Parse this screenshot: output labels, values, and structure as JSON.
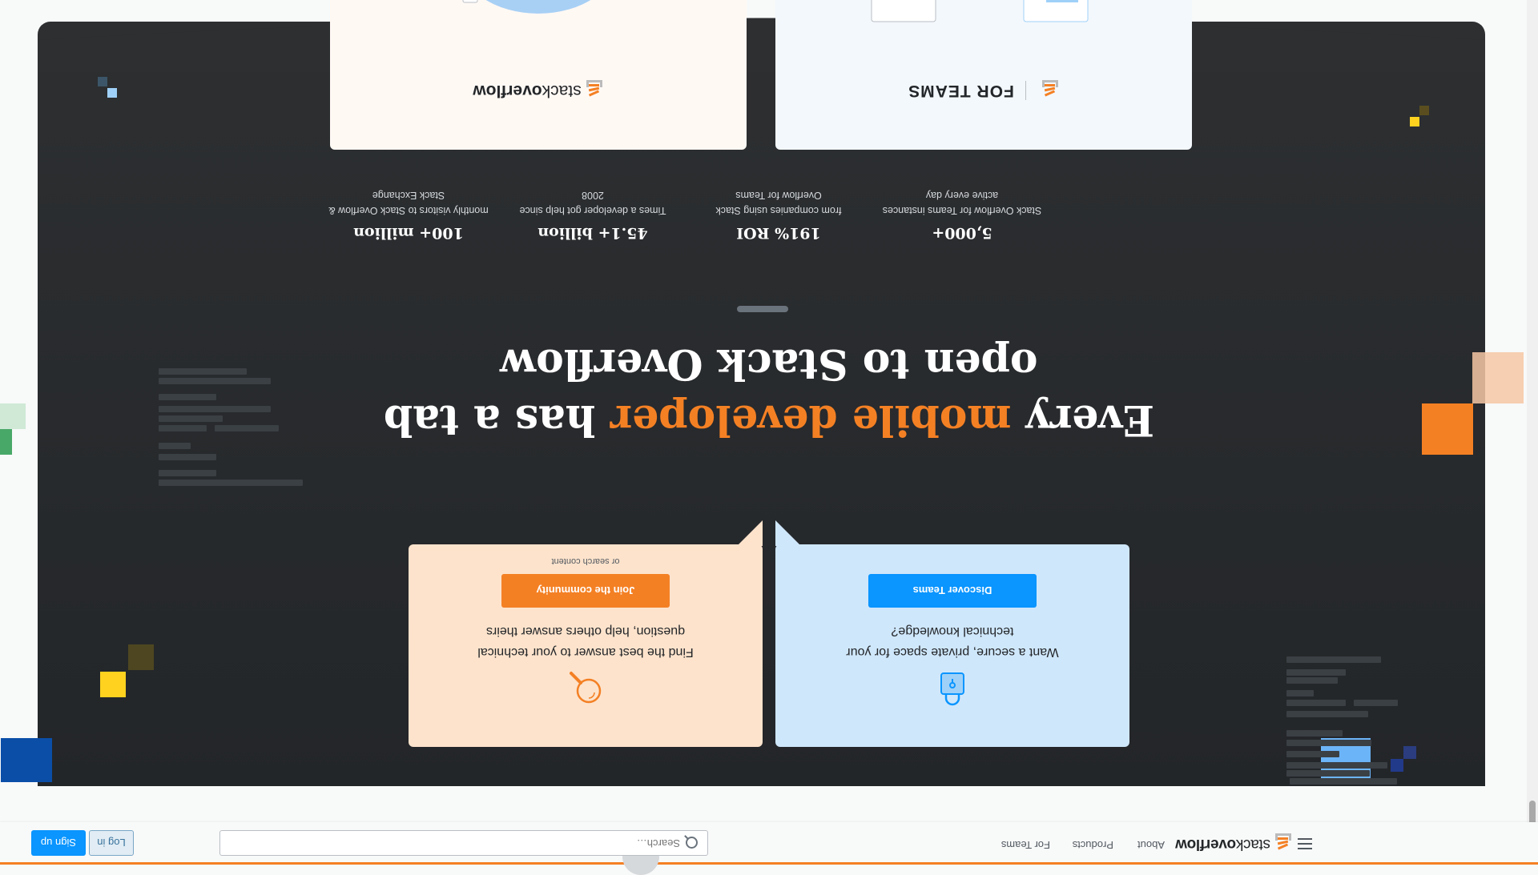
{
  "topbar": {
    "logo_light": "stack",
    "logo_bold": "overflow",
    "nav": [
      "About",
      "Products",
      "For Teams"
    ],
    "search_placeholder": "Search…",
    "login_label": "Log in",
    "signup_label": "Sign up",
    "close_glyph": "×"
  },
  "hero": {
    "headline_pre": "Every ",
    "headline_accent": "mobile developer",
    "headline_post": " has a tab open to Stack Overflow"
  },
  "cards": {
    "teams": {
      "icon": "lock-icon",
      "description": "Want a secure, private space for your technical knowledge?",
      "cta": "Discover Teams"
    },
    "community": {
      "icon": "search-icon",
      "description": "Find the best answer to your technical question, help others answer theirs",
      "cta": "Join the community",
      "sub": "or search content"
    }
  },
  "stats": [
    {
      "number": "100+ million",
      "label": "monthly visitors to Stack Overflow & Stack Exchange"
    },
    {
      "number": "45.1+ billion",
      "label": "Times a developer got help since 2008"
    },
    {
      "number": "191% ROI",
      "label": "from companies using Stack Overflow for Teams"
    },
    {
      "number": "5,000+",
      "label": "Stack Overflow for Teams instances active every day"
    }
  ],
  "promos": {
    "teams_label": "FOR TEAMS",
    "so_light": "stack",
    "so_bold": "overflow"
  },
  "colors": {
    "accent_orange": "#f48024",
    "accent_blue": "#0a95ff",
    "dark_bg": "#2d2f31"
  }
}
